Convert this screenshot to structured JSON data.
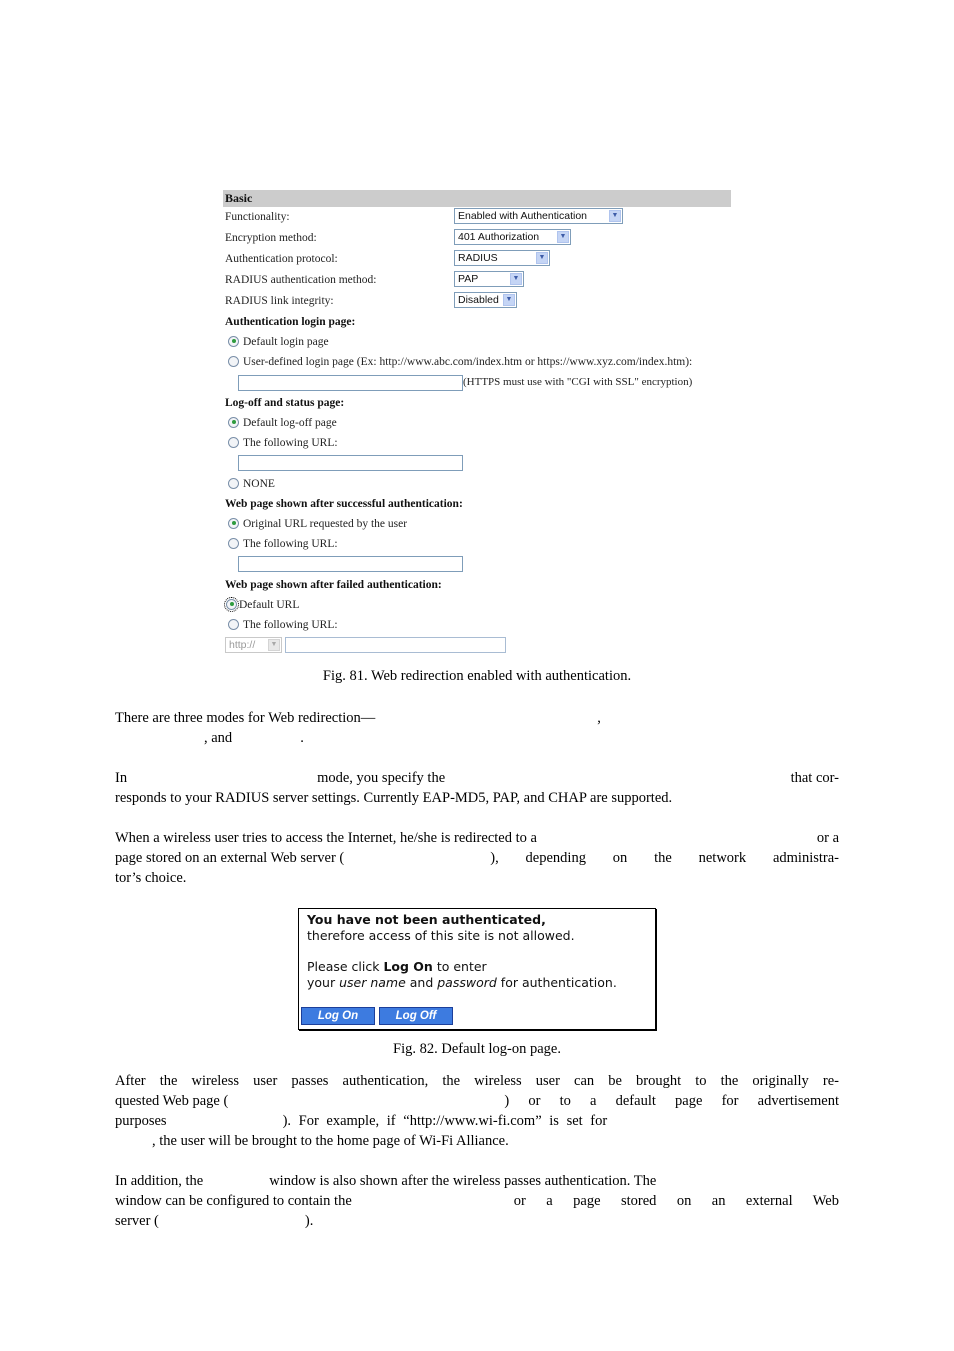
{
  "figure81": {
    "section_title": "Basic",
    "fields": [
      {
        "label": "Functionality:",
        "value": "Enabled with Authentication"
      },
      {
        "label": "Encryption method:",
        "value": "401 Authorization"
      },
      {
        "label": "Authentication protocol:",
        "value": "RADIUS"
      },
      {
        "label": "RADIUS authentication method:",
        "value": "PAP"
      },
      {
        "label": "RADIUS link integrity:",
        "value": "Disabled"
      }
    ],
    "login_page": {
      "heading": "Authentication login page:",
      "options": [
        "Default login page",
        "User-defined login page (Ex: http://www.abc.com/index.htm or https://www.xyz.com/index.htm):"
      ],
      "selected": 0,
      "url_value": "",
      "https_note": "(HTTPS must use with \"CGI with SSL\" encryption)"
    },
    "logoff_page": {
      "heading": "Log-off and status page:",
      "options": [
        "Default log-off page",
        "The following URL:",
        "NONE"
      ],
      "selected": 0,
      "url_value": ""
    },
    "success_page": {
      "heading": "Web page shown after successful authentication:",
      "options": [
        "Original URL requested by the user",
        "The following URL:"
      ],
      "selected": 0,
      "url_value": ""
    },
    "failed_page": {
      "heading": "Web page shown after failed authentication:",
      "options": [
        "Default URL",
        "The following URL:"
      ],
      "selected": 0,
      "protocol_value": "http://",
      "url_value": ""
    },
    "caption": "Fig. 81. Web redirection enabled with authentication."
  },
  "paragraphs": {
    "p1_a": "There are three modes for Web redirection—",
    "p1_b": ",",
    "p1_c": ", and",
    "p1_d": ".",
    "p2_a": "In",
    "p2_b": "mode, you specify the",
    "p2_c": "that cor-",
    "p2_d": "responds to your RADIUS server settings. Currently EAP-MD5, PAP, and CHAP are supported.",
    "p3_a": "When a wireless user tries to access the Internet, he/she is redirected to a",
    "p3_b": "or a",
    "p3_c": "page stored on an external Web server (",
    "p3_d": "), depending on the network administra-",
    "p3_e": "tor’s choice.",
    "p4_a": "After the wireless user passes authentication, the wireless user can be brought to the originally re-",
    "p4_b": "quested Web page (",
    "p4_c": ") or to a default page for advertisement",
    "p4_d": "purposes",
    "p4_e": "). For example, if “http://www.wi-fi.com” is set for",
    "p4_f": ", the user will be brought to the home page of Wi-Fi Alliance.",
    "p5_a": "In addition, the",
    "p5_b": "window is also shown after the wireless passes authentication. The",
    "p5_c": "window can be configured to contain the",
    "p5_d": "or a page stored on an external Web",
    "p5_e": "server (",
    "p5_f": ")."
  },
  "figure82": {
    "line1": "You have not been authenticated,",
    "line2": "therefore access of this site is not allowed.",
    "line3_a": "Please click ",
    "line3_b": "Log On",
    "line3_c": " to enter",
    "line4_a": "your ",
    "line4_b": "user name",
    "line4_c": " and ",
    "line4_d": "password",
    "line4_e": " for authentication.",
    "logon_button": "Log On",
    "logoff_button": "Log Off",
    "caption": "Fig. 82. Default log-on page."
  }
}
